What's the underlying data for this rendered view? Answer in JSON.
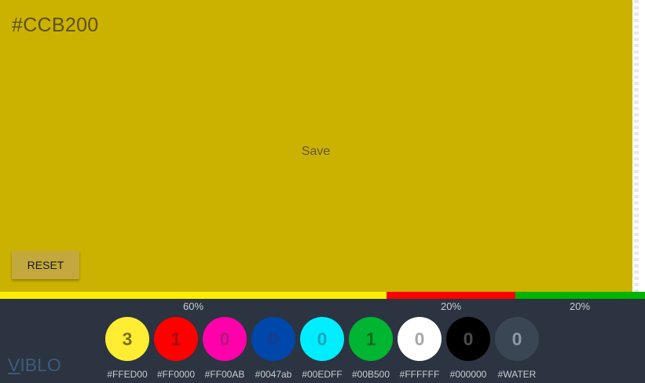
{
  "editor": {
    "hex_value": "#CCB200",
    "save_label": "Save",
    "reset_label": "RESET",
    "background_color": "#ccb200"
  },
  "distribution": [
    {
      "percent_label": "60%",
      "color": "#FFED00"
    },
    {
      "percent_label": "20%",
      "color": "#FF0000"
    },
    {
      "percent_label": "20%",
      "color": "#00B500"
    }
  ],
  "palette": [
    {
      "count": "3",
      "label": "#FFED00",
      "color": "#ffed33",
      "text_color": "#7a6f1e"
    },
    {
      "count": "1",
      "label": "#FF0000",
      "color": "#ff0000",
      "text_color": "#a31010"
    },
    {
      "count": "0",
      "label": "#FF00AB",
      "color": "#ff00ab",
      "text_color": "#b01a7a"
    },
    {
      "count": "0",
      "label": "#0047ab",
      "color": "#0047ab",
      "text_color": "#1c3b86"
    },
    {
      "count": "0",
      "label": "#00EDFF",
      "color": "#00edff",
      "text_color": "#1aa7b8"
    },
    {
      "count": "1",
      "label": "#00B500",
      "color": "#00b532",
      "text_color": "#0e6e1e"
    },
    {
      "count": "0",
      "label": "#FFFFFF",
      "color": "#ffffff",
      "text_color": "#a8a8a8"
    },
    {
      "count": "0",
      "label": "#000000",
      "color": "#000000",
      "text_color": "#4a4a4a"
    },
    {
      "count": "0",
      "label": "#WATER",
      "color": "#3a4653",
      "text_color": "#8f99a6"
    }
  ],
  "branding": {
    "logo_first": "V",
    "logo_rest": "IBLO"
  }
}
